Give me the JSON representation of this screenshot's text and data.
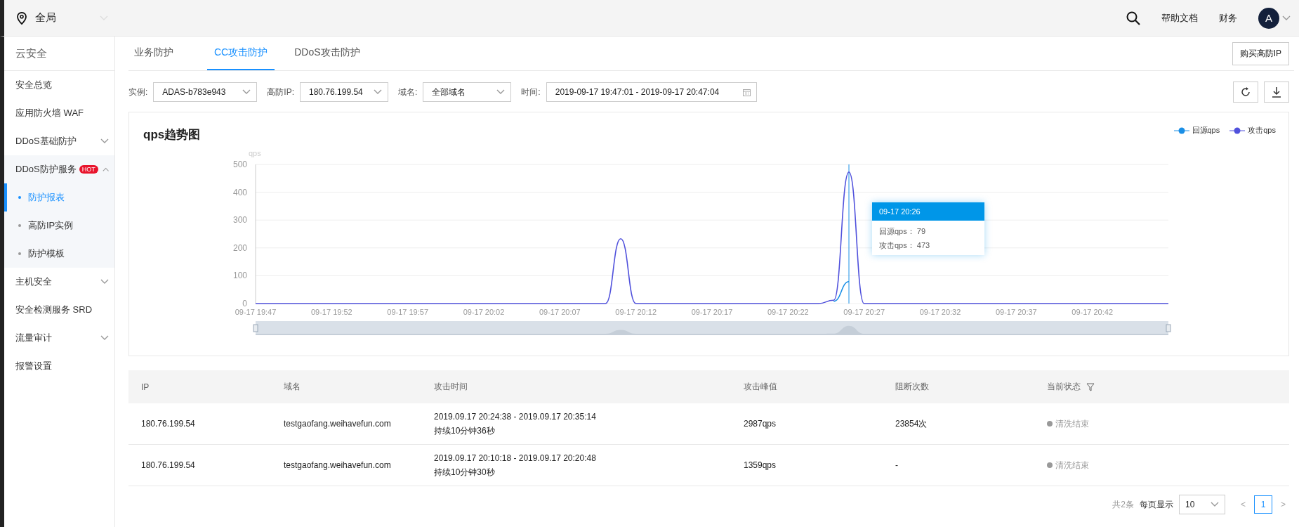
{
  "topbar": {
    "region": "全局",
    "links": [
      "帮助文档",
      "财务"
    ],
    "avatar": "A"
  },
  "sidebar": {
    "title": "云安全",
    "items": [
      {
        "label": "安全总览",
        "kind": "link"
      },
      {
        "label": "应用防火墙 WAF",
        "kind": "link"
      },
      {
        "label": "DDoS基础防护",
        "kind": "group",
        "expanded": false
      },
      {
        "label": "DDoS防护服务",
        "kind": "group",
        "expanded": true,
        "badge": "HOT",
        "children": [
          {
            "label": "防护报表",
            "selected": true
          },
          {
            "label": "高防IP实例",
            "selected": false
          },
          {
            "label": "防护模板",
            "selected": false
          }
        ]
      },
      {
        "label": "主机安全",
        "kind": "group",
        "expanded": false
      },
      {
        "label": "安全检测服务 SRD",
        "kind": "link"
      },
      {
        "label": "流量审计",
        "kind": "group",
        "expanded": false
      },
      {
        "label": "报警设置",
        "kind": "link"
      }
    ]
  },
  "tabs": [
    {
      "label": "业务防护",
      "selected": false
    },
    {
      "label": "CC攻击防护",
      "selected": true
    },
    {
      "label": "DDoS攻击防护",
      "selected": false
    }
  ],
  "buy_button": "购买高防IP",
  "filters": [
    {
      "label": "实例:",
      "value": "ADAS-b783e943",
      "kind": "select"
    },
    {
      "label": "高防IP:",
      "value": "180.76.199.54",
      "kind": "select"
    },
    {
      "label": "域名:",
      "value": "全部域名",
      "kind": "select"
    },
    {
      "label": "时间:",
      "value": "2019-09-17 19:47:01 - 2019-09-17 20:47:04",
      "kind": "date"
    }
  ],
  "chart": {
    "title": "qps趋势图",
    "chart_data": {
      "type": "line",
      "ylabel": "qps",
      "categories": [
        "09-17 19:47",
        null,
        null,
        null,
        null,
        "09-17 19:52",
        null,
        null,
        null,
        null,
        "09-17 19:57",
        null,
        null,
        null,
        null,
        "09-17 20:02",
        null,
        null,
        null,
        null,
        "09-17 20:07",
        null,
        null,
        null,
        null,
        "09-17 20:12",
        null,
        null,
        null,
        null,
        "09-17 20:17",
        null,
        null,
        null,
        null,
        "09-17 20:22",
        null,
        null,
        null,
        null,
        "09-17 20:27",
        null,
        null,
        null,
        null,
        "09-17 20:32",
        null,
        null,
        null,
        null,
        "09-17 20:37",
        null,
        null,
        null,
        null,
        "09-17 20:42",
        null,
        null,
        null,
        null,
        null
      ],
      "ylim": [
        0,
        500
      ],
      "grid": true,
      "yticks": [
        0,
        100,
        200,
        300,
        400,
        500
      ],
      "series": [
        {
          "name": "回源qps",
          "color": "#1a8fe6",
          "values": [
            null,
            null,
            null,
            null,
            null,
            null,
            null,
            null,
            null,
            null,
            null,
            null,
            null,
            null,
            null,
            null,
            null,
            null,
            null,
            null,
            null,
            null,
            null,
            null,
            null,
            null,
            null,
            null,
            null,
            null,
            null,
            null,
            null,
            null,
            null,
            null,
            null,
            null,
            8,
            79,
            null,
            null,
            null,
            null,
            null,
            null,
            null,
            null,
            null,
            null,
            null,
            null,
            null,
            null,
            null,
            null,
            null,
            null,
            null,
            null,
            null
          ]
        },
        {
          "name": "攻击qps",
          "color": "#5051dc",
          "values": [
            0,
            0,
            0,
            0,
            0,
            0,
            0,
            0,
            0,
            0,
            0,
            0,
            0,
            0,
            0,
            0,
            0,
            0,
            0,
            0,
            0,
            0,
            0,
            0,
            233,
            0,
            0,
            0,
            0,
            0,
            0,
            0,
            0,
            0,
            0,
            0,
            0,
            0,
            12,
            473,
            0,
            0,
            0,
            0,
            0,
            0,
            0,
            0,
            0,
            0,
            0,
            0,
            0,
            0,
            0,
            0,
            0,
            0,
            0,
            0,
            0
          ]
        }
      ]
    },
    "tooltip": {
      "title": "09-17 20:26",
      "rows": [
        {
          "label": "回源qps：",
          "value": "79"
        },
        {
          "label": "攻击qps：",
          "value": "473"
        }
      ]
    }
  },
  "table": {
    "columns": [
      "IP",
      "域名",
      "攻击时间",
      "攻击峰值",
      "阻断次数",
      "当前状态"
    ],
    "rows": [
      {
        "ip": "180.76.199.54",
        "domain": "testgaofang.weihavefun.com",
        "time": "2019.09.17 20:24:38 - 2019.09.17 20:35:14",
        "duration": "持续10分钟36秒",
        "peak": "2987qps",
        "blocks": "23854次",
        "status": "清洗结束"
      },
      {
        "ip": "180.76.199.54",
        "domain": "testgaofang.weihavefun.com",
        "time": "2019.09.17 20:10:18 - 2019.09.17 20:20:48",
        "duration": "持续10分钟30秒",
        "peak": "1359qps",
        "blocks": "-",
        "status": "清洗结束"
      }
    ]
  },
  "pagination": {
    "total": "共2条",
    "page_size_label": "每页显示",
    "page_size": "10",
    "prev": "<",
    "pages": [
      {
        "label": "1",
        "selected": true
      }
    ],
    "next": ">"
  }
}
